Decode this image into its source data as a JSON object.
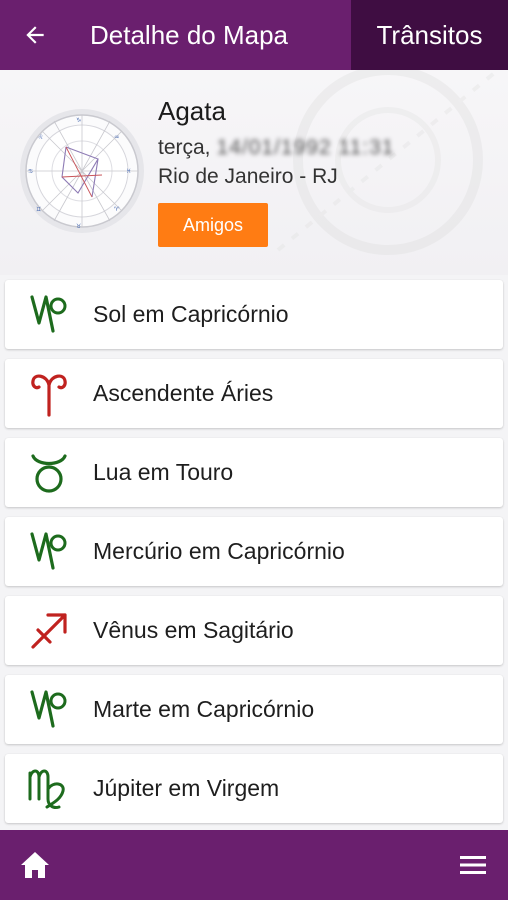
{
  "header": {
    "back_icon": "arrow-left-icon",
    "title": "Detalhe do Mapa",
    "transits_label": "Trânsitos",
    "bar_color": "#6a1f6e",
    "active_tab_color": "#3f0d42"
  },
  "profile": {
    "name": "Agata",
    "weekday": "terça,",
    "birth_datetime_blurred": "14/01/1992 11:31",
    "place": "Rio de Janeiro - RJ",
    "friends_button": "Amigos",
    "friends_button_color": "#ff7c13",
    "chart_icon": "natal-chart-wheel-icon"
  },
  "placements": [
    {
      "label": "Sol em Capricórnio",
      "icon": "capricorn-icon",
      "color": "#1d6b1d"
    },
    {
      "label": "Ascendente Áries",
      "icon": "aries-icon",
      "color": "#c0221f"
    },
    {
      "label": "Lua em Touro",
      "icon": "taurus-icon",
      "color": "#1d6b1d"
    },
    {
      "label": "Mercúrio em Capricórnio",
      "icon": "capricorn-icon",
      "color": "#1d6b1d"
    },
    {
      "label": "Vênus em Sagitário",
      "icon": "sagittarius-icon",
      "color": "#c0221f"
    },
    {
      "label": "Marte em Capricórnio",
      "icon": "capricorn-icon",
      "color": "#1d6b1d"
    },
    {
      "label": "Júpiter em Virgem",
      "icon": "virgo-icon",
      "color": "#1d6b1d"
    }
  ],
  "footer": {
    "home_icon": "home-icon",
    "menu_icon": "hamburger-menu-icon"
  }
}
